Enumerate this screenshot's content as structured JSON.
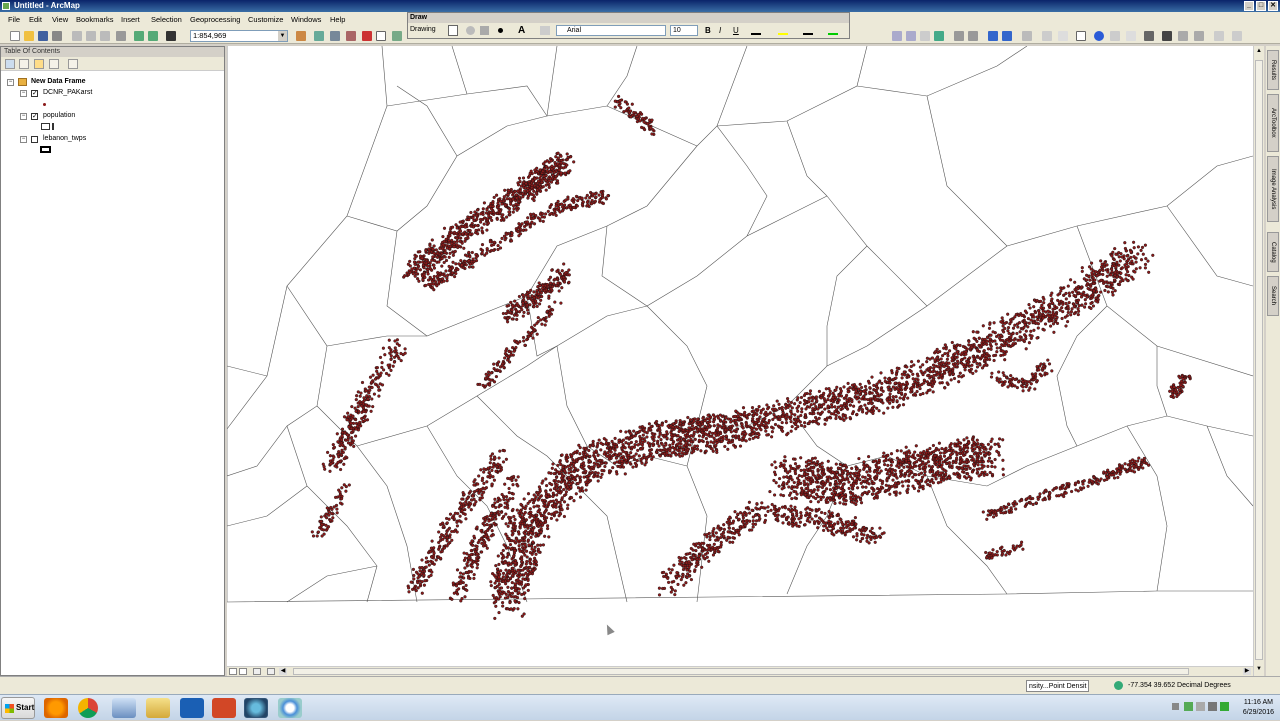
{
  "window": {
    "title": "Untitled - ArcMap",
    "min": "_",
    "max": "□",
    "close": "✕"
  },
  "menu": [
    "File",
    "Edit",
    "View",
    "Bookmarks",
    "Insert",
    "Selection",
    "Geoprocessing",
    "Customize",
    "Windows",
    "Help"
  ],
  "toolbar": {
    "scale": "1:854,969"
  },
  "draw_toolbar": {
    "title": "Draw",
    "drawing_label": "Drawing",
    "font": "Arial",
    "size": "10",
    "bold": "B",
    "italic": "I",
    "underline": "U",
    "text_tool": "A"
  },
  "toc": {
    "title": "Table Of Contents",
    "frame": "New Data Frame",
    "layers": [
      {
        "name": "DCNR_PAKarst",
        "checked": true
      },
      {
        "name": "population",
        "checked": true
      },
      {
        "name": "lebanon_twps",
        "checked": false
      }
    ]
  },
  "side_tabs": [
    "Results",
    "ArcToolbox",
    "Image Analysis",
    "Catalog",
    "Search"
  ],
  "status": {
    "tool_text": "nsity...Point Densit",
    "coordinates": "-77.354  39.652 Decimal Degrees"
  },
  "taskbar": {
    "start": "Start",
    "time": "11:16 AM",
    "date": "6/29/2016"
  },
  "colors": {
    "karst_points": "#8b1a1a",
    "title_bar": "#0a246a",
    "map_bg": "#ffffff",
    "boundaries": "#555555"
  }
}
